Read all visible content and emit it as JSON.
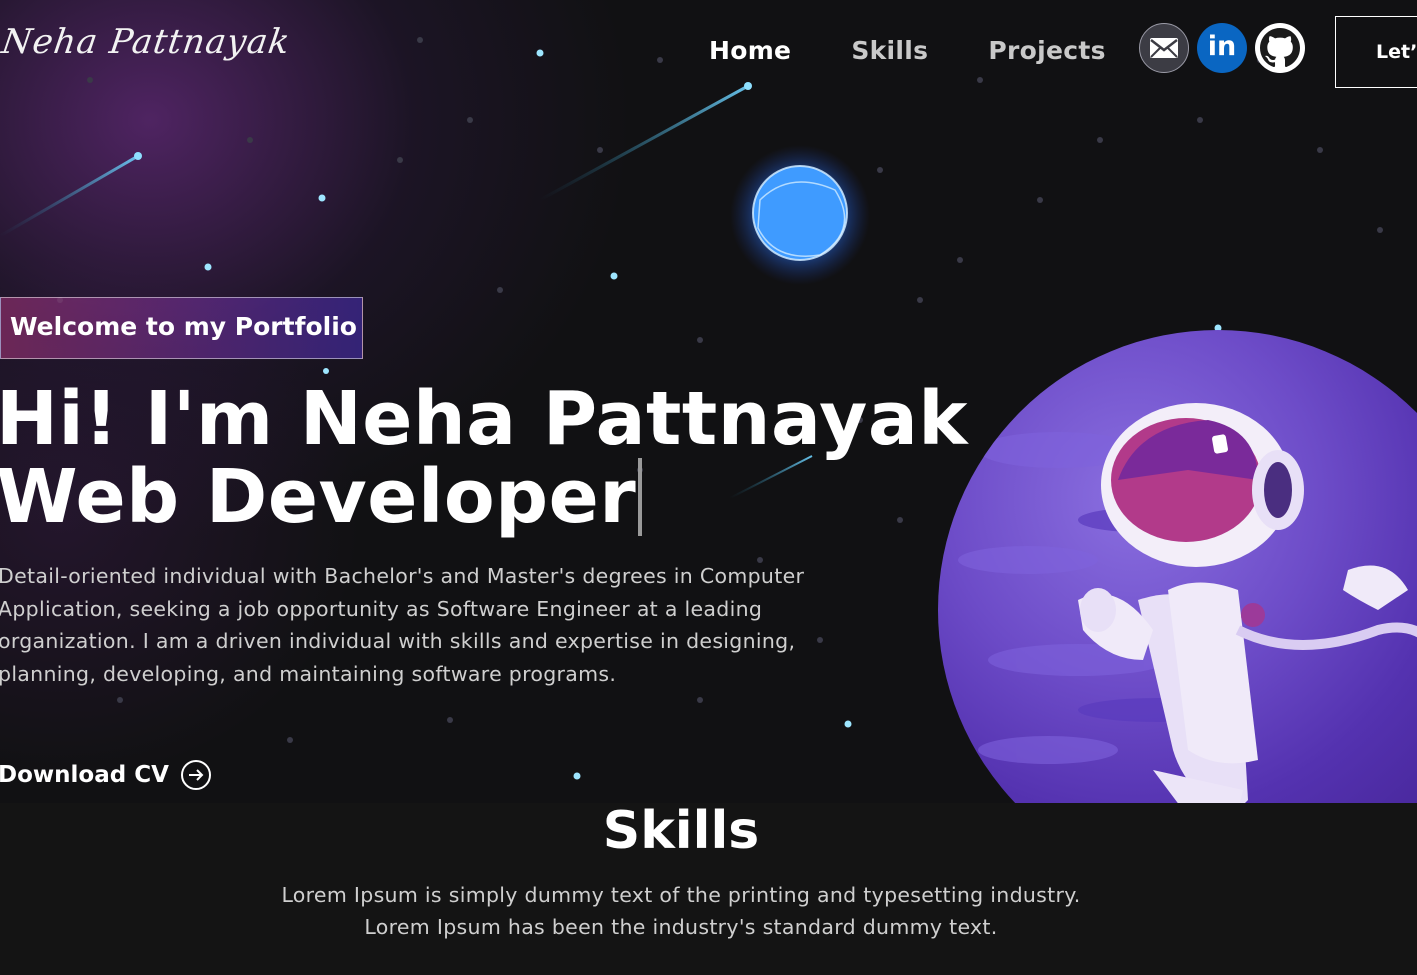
{
  "logo": {
    "text": "Neha Pattnayak"
  },
  "nav": {
    "items": [
      {
        "label": "Home",
        "active": true
      },
      {
        "label": "Skills",
        "active": false
      },
      {
        "label": "Projects",
        "active": false
      }
    ]
  },
  "social": {
    "icons": [
      "email-icon",
      "linkedin-icon",
      "github-icon"
    ],
    "linkedin_text": "in"
  },
  "connect_button": {
    "label": "Let’s Connect"
  },
  "hero": {
    "tagline": "Welcome to my Portfolio",
    "headline_line1": "Hi! I'm Neha Pattnayak",
    "headline_line2": "Web Developer",
    "intro": "Detail-oriented individual with Bachelor's and Master's degrees in Computer Application, seeking a job opportunity as Software Engineer at a leading organization. I am a driven individual with skills and expertise in designing, planning, developing, and maintaining software programs.",
    "download_label": "Download CV"
  },
  "skills": {
    "title": "Skills",
    "desc_line1": "Lorem Ipsum is simply dummy text of the printing and typesetting industry.",
    "desc_line2": "Lorem Ipsum has been the industry's standard dummy text."
  },
  "colors": {
    "background": "#121212",
    "linkedin": "#0a66c2",
    "planet": "#6d4cc8",
    "tagline_gradient_start": "#aa367c",
    "tagline_gradient_end": "#4a2fbd"
  }
}
